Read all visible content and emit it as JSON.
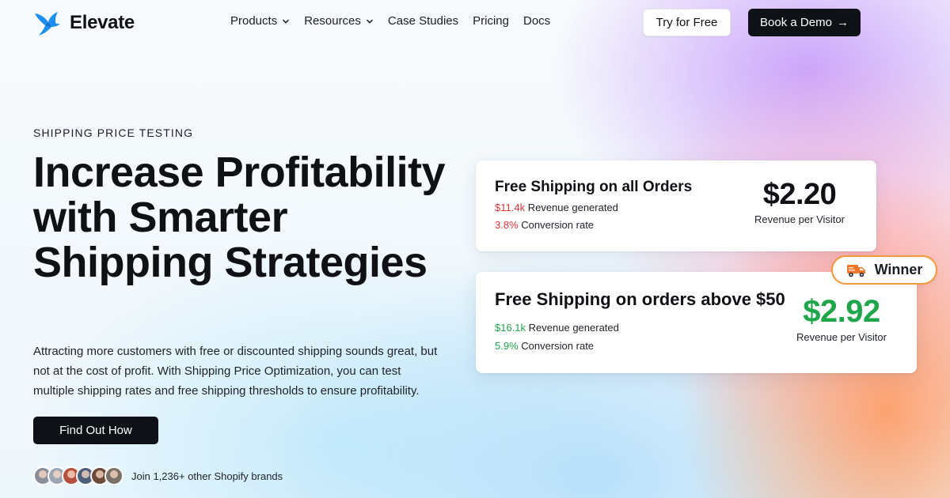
{
  "header": {
    "brand": "Elevate",
    "nav": [
      {
        "label": "Products",
        "has_dropdown": true
      },
      {
        "label": "Resources",
        "has_dropdown": true
      },
      {
        "label": "Case Studies",
        "has_dropdown": false
      },
      {
        "label": "Pricing",
        "has_dropdown": false
      },
      {
        "label": "Docs",
        "has_dropdown": false
      }
    ],
    "try_label": "Try for Free",
    "demo_label": "Book a Demo"
  },
  "hero": {
    "eyebrow": "SHIPPING PRICE TESTING",
    "headline": "Increase Profitability with Smarter Shipping Strategies",
    "description": "Attracting more customers with free or discounted shipping sounds great, but not at the cost of profit. With Shipping Price Optimization, you can test multiple shipping rates and free shipping thresholds to ensure profitability.",
    "cta_label": "Find Out How",
    "social_proof": "Join 1,236+ other Shopify brands",
    "avatar_count": 6
  },
  "cards": [
    {
      "title": "Free Shipping on all Orders",
      "revenue_value": "$11.4k",
      "revenue_label": "Revenue generated",
      "conversion_value": "3.8%",
      "conversion_label": "Conversion rate",
      "metric_value": "$2.20",
      "metric_label": "Revenue per Visitor"
    },
    {
      "title": "Free Shipping on orders above $50",
      "revenue_value": "$16.1k",
      "revenue_label": "Revenue generated",
      "conversion_value": "5.9%",
      "conversion_label": "Conversion rate",
      "metric_value": "$2.92",
      "metric_label": "Revenue per Visitor"
    }
  ],
  "winner_badge": {
    "label": "Winner",
    "icon": "truck-icon"
  },
  "colors": {
    "brand_blue": "#1f8ef1",
    "dark": "#0e1116",
    "loss_red": "#e0343a",
    "win_green": "#1fa64a",
    "badge_orange": "#f29a3a"
  }
}
